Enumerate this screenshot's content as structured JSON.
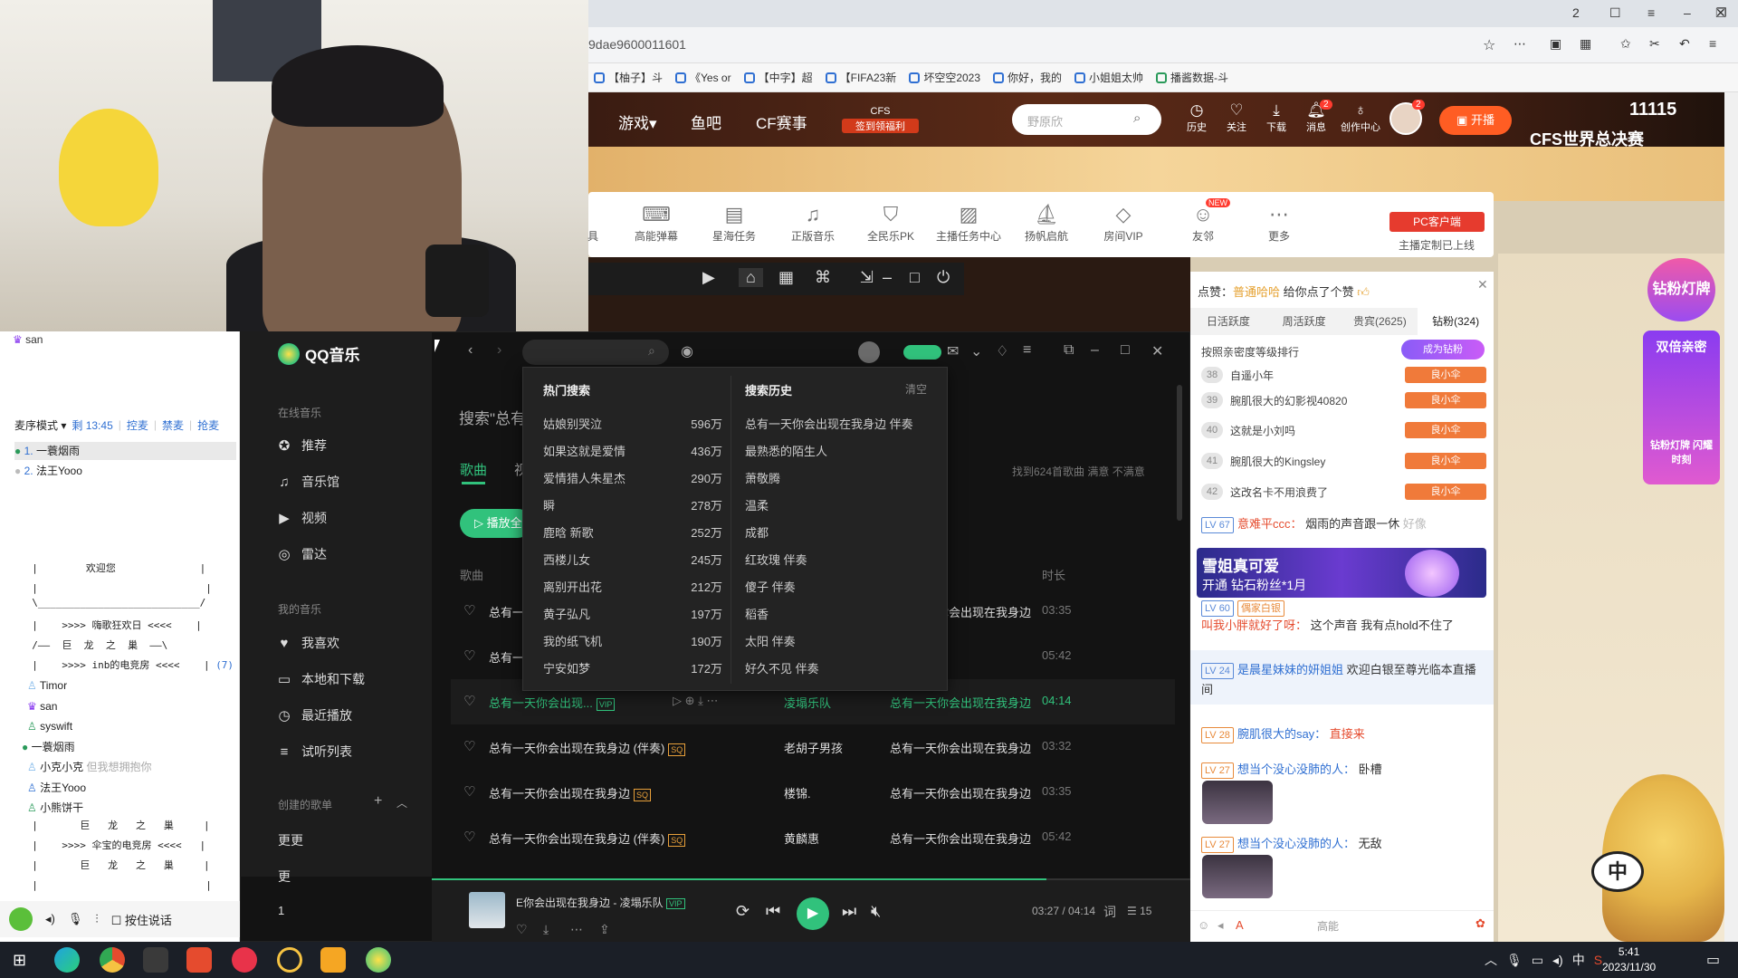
{
  "browser": {
    "url": "9dae9600011601",
    "tab_count": "2",
    "bookmarks": [
      "【柚子】斗",
      "《Yes or ",
      "【中字】超",
      "【FIFA23新",
      "坏空空2023",
      "你好，我的",
      "小姐姐太帅",
      "播酱数据-斗"
    ]
  },
  "douyu": {
    "nav": [
      "游戏",
      "鱼吧",
      "CF赛事"
    ],
    "cfs_badge": "CFS",
    "cfs_badge_sub": "签到领福利",
    "search_placeholder": "野原欣",
    "icons": [
      {
        "label": "历史",
        "icon": "clock-icon"
      },
      {
        "label": "关注",
        "icon": "heart-icon"
      },
      {
        "label": "下载",
        "icon": "download-icon"
      },
      {
        "label": "消息",
        "icon": "bell-icon"
      },
      {
        "label": "创作中心",
        "icon": "bulb-icon"
      }
    ],
    "msg_badge": "2",
    "avatar_badge": "2",
    "kaibo": "开播",
    "score": "11115",
    "cfs_final": "CFS世界总决赛"
  },
  "toolbar": {
    "items": [
      "具",
      "高能弹幕",
      "星海任务",
      "正版音乐",
      "全民乐PK",
      "主播任务中心",
      "扬帆启航",
      "房间VIP",
      "友邻",
      "更多"
    ],
    "new_badge": "NEW",
    "pc_client": "PC客户端",
    "pc_client_sub": "主播定制已上线"
  },
  "chat": {
    "like_prefix": "点赞：",
    "like_user": "普通哈哈",
    "like_suffix": "给你点了个赞",
    "tabs": [
      "日活跃度",
      "周活跃度",
      "贵宾(2625)",
      "钻粉(324)"
    ],
    "rank_sub": "按照亲密度等级排行",
    "become_fan": "成为钻粉",
    "ranks": [
      {
        "n": "38",
        "name": "自遥小年",
        "badge": "良小伞"
      },
      {
        "n": "39",
        "name": "腕肌很大的幻影视40820",
        "badge": "良小伞"
      },
      {
        "n": "40",
        "name": "这就是小刘吗",
        "badge": "良小伞"
      },
      {
        "n": "41",
        "name": "腕肌很大的Kingsley",
        "badge": "良小伞"
      },
      {
        "n": "42",
        "name": "这改名卡不用浪费了",
        "badge": "良小伞"
      }
    ],
    "messages": [
      {
        "lv": "LV 67",
        "user": "意难平ccc：",
        "text": "烟雨的声音跟一休",
        "more": "好像"
      },
      {
        "user": "叫我小胖就好了呀：",
        "text": "这个声音 我有点hold不住了"
      },
      {
        "lv": "LV 24",
        "user": "是晨星妹妹的妍姐姐",
        "text": "欢迎白银至尊光临本直播间"
      },
      {
        "lv": "LV 28",
        "user": "腕肌很大的say：",
        "text": "直接来"
      },
      {
        "lv": "LV 27",
        "user": "想当个没心没肺的人：",
        "text": "卧槽"
      },
      {
        "lv": "LV 27",
        "user": "想当个没心没肺的人：",
        "text": "无敌"
      }
    ],
    "fan_banner_title": "雪姐真可爱",
    "fan_banner_sub": "开通  钻石粉丝*1月",
    "lv60": "LV 60",
    "fan_badge": "偶家白银",
    "bottom_hi": "高能"
  },
  "right": {
    "diamond": "钻粉灯牌",
    "double_gift": "双倍亲密",
    "double_sub": "钻粉灯牌 闪耀时刻",
    "mascot_bubble": "中"
  },
  "yy": {
    "top_user": "san",
    "mode": "麦序模式",
    "time": "剩 13:45",
    "links": [
      "控麦",
      "禁麦",
      "抢麦"
    ],
    "queue": [
      {
        "n": "1.",
        "name": "一蓑烟雨"
      },
      {
        "n": "2.",
        "name": "法王Yooo"
      }
    ],
    "tree": [
      "  |        欢迎您              |",
      "  |                            |",
      "  \\___________________________/",
      "  |    >>>> 嗨歌狂欢日 <<<<    |",
      "  /——  巨  龙  之  巢  ——\\",
      "  |    >>>> inb的电竞房 <<<<    | (7)"
    ],
    "count": "(7)",
    "users": [
      "Timor",
      "san",
      "syswift",
      "一蓑烟雨",
      "小克小克",
      "法王Yooo",
      "小熊饼干"
    ],
    "user_note": "但我想拥抱你",
    "tree2": [
      "  |       巨   龙   之   巢     |",
      "  |    >>>> 伞宝的电竞房 <<<<   |",
      "  |       巨   龙   之   巢     |",
      "  |                            |"
    ],
    "push_to_talk": "按住说话"
  },
  "qqmusic": {
    "app_name": "QQ音乐",
    "sections": {
      "online": "在线音乐",
      "mine": "我的音乐",
      "created": "创建的歌单"
    },
    "online_nav": [
      {
        "label": "推荐",
        "icon": "compass-icon"
      },
      {
        "label": "音乐馆",
        "icon": "music-note-icon"
      },
      {
        "label": "视频",
        "icon": "video-icon"
      },
      {
        "label": "雷达",
        "icon": "radar-icon"
      }
    ],
    "mine_nav": [
      {
        "label": "我喜欢",
        "icon": "heart-icon"
      },
      {
        "label": "本地和下载",
        "icon": "monitor-icon"
      },
      {
        "label": "最近播放",
        "icon": "clock-icon"
      },
      {
        "label": "试听列表",
        "icon": "list-icon"
      }
    ],
    "playlists": [
      "更更",
      "更",
      "1"
    ],
    "search_title": "搜索\"总有",
    "tab_songs": "歌曲",
    "tab_other": "视",
    "result_info": "找到624首歌曲  满意  不满意",
    "play_all": "播放全部",
    "col_song": "歌曲",
    "col_duration": "时长",
    "songs": [
      {
        "title": "总有一",
        "artist": "",
        "album": "总有一天你会出现在我身边",
        "duration": "03:35",
        "tag": ""
      },
      {
        "title": "总有一",
        "artist": "",
        "album": "",
        "duration": "05:42",
        "tag": ""
      },
      {
        "title": "总有一天你会出现...",
        "artist": "凌塌乐队",
        "album": "总有一天你会出现在我身边",
        "duration": "04:14",
        "tag": "VIP"
      },
      {
        "title": "总有一天你会出现在我身边 (伴奏)",
        "artist": "老胡子男孩",
        "album": "总有一天你会出现在我身边",
        "duration": "03:32",
        "tag": "SQ"
      },
      {
        "title": "总有一天你会出现在我身边",
        "artist": "楼锦.",
        "album": "总有一天你会出现在我身边",
        "duration": "03:35",
        "tag": "SQ"
      },
      {
        "title": "总有一天你会出现在我身边 (伴奏)",
        "artist": "黄麟惠",
        "album": "总有一天你会出现在我身边",
        "duration": "05:42",
        "tag": "SQ"
      }
    ],
    "dropdown": {
      "hot_title": "热门搜索",
      "history_title": "搜索历史",
      "clear": "清空",
      "hot": [
        {
          "q": "姑娘别哭泣",
          "c": "596万"
        },
        {
          "q": "如果这就是爱情",
          "c": "436万"
        },
        {
          "q": "爱情猎人朱星杰",
          "c": "290万"
        },
        {
          "q": "瞬",
          "c": "278万"
        },
        {
          "q": "鹿晗 新歌",
          "c": "252万"
        },
        {
          "q": "西楼儿女",
          "c": "245万"
        },
        {
          "q": "离别开出花",
          "c": "212万"
        },
        {
          "q": "黄子弘凡",
          "c": "197万"
        },
        {
          "q": "我的纸飞机",
          "c": "190万"
        },
        {
          "q": "宁安如梦",
          "c": "172万"
        }
      ],
      "history": [
        "总有一天你会出现在我身边 伴奏",
        "最熟悉的陌生人",
        "萧敬腾",
        "温柔",
        "成都",
        "红玫瑰 伴奏",
        "傻子 伴奏",
        "稻香",
        "太阳 伴奏",
        "好久不见 伴奏"
      ]
    },
    "now_playing": "E你会出现在我身边 - 凌塌乐队",
    "now_tag": "VIP",
    "time": "03:27 / 04:14",
    "lyric_btn": "词",
    "playlist_count": "15",
    "progress": 0.81
  },
  "taskbar": {
    "time": "5:41",
    "date": "2023/11/30",
    "ime": "中"
  }
}
